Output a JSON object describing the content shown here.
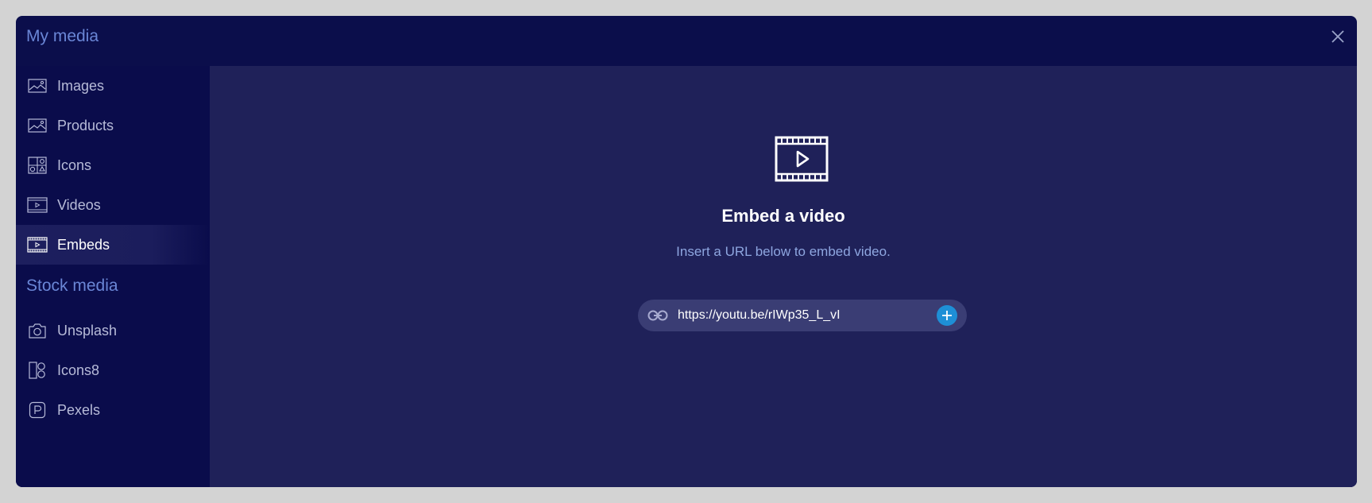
{
  "modal": {
    "title": "My media",
    "close_icon": "close-icon"
  },
  "sidebar": {
    "my_media_items": [
      {
        "label": "Images",
        "icon": "image-icon"
      },
      {
        "label": "Products",
        "icon": "image-icon"
      },
      {
        "label": "Icons",
        "icon": "icons-grid-icon"
      },
      {
        "label": "Videos",
        "icon": "video-icon"
      },
      {
        "label": "Embeds",
        "icon": "film-icon",
        "active": true
      }
    ],
    "stock_title": "Stock media",
    "stock_items": [
      {
        "label": "Unsplash",
        "icon": "camera-icon"
      },
      {
        "label": "Icons8",
        "icon": "icons8-icon"
      },
      {
        "label": "Pexels",
        "icon": "pexels-icon"
      }
    ]
  },
  "embed": {
    "title": "Embed a video",
    "subtitle": "Insert a URL below to embed video.",
    "url_value": "https://youtu.be/rIWp35_L_vI",
    "add_icon": "plus-icon",
    "link_icon": "link-icon"
  },
  "colors": {
    "modal_bg": "#0b0e4b",
    "main_bg": "#1f2159",
    "accent_title": "#6a86d6",
    "add_button": "#1e8fd6"
  }
}
